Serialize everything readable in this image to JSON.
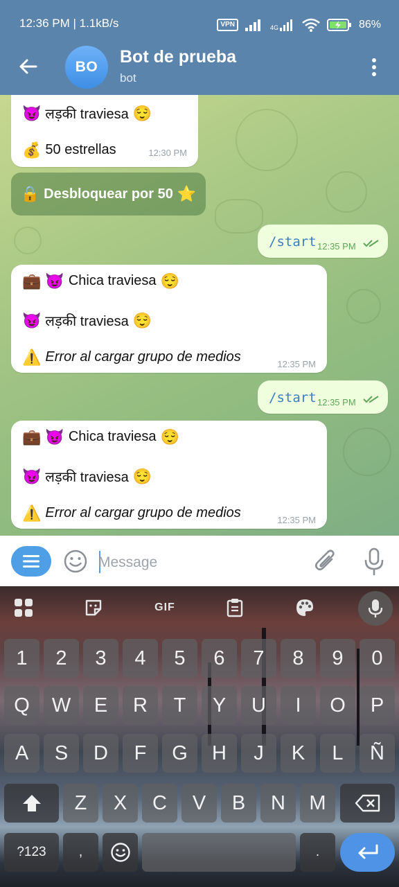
{
  "status_bar": {
    "time": "12:36 PM | 1.1kB/s",
    "vpn": "VPN",
    "network": "4G",
    "battery": "86%"
  },
  "header": {
    "avatar_initials": "BO",
    "title": "Bot de prueba",
    "subtitle": "bot"
  },
  "messages": {
    "partial": {
      "line1": "लड़की traviesa",
      "line2": "50 estrellas",
      "time": "12:30 PM"
    },
    "unlock_button": "Desbloquear por 50",
    "out1": {
      "text": "/start",
      "time": "12:35 PM"
    },
    "in1": {
      "line1": "Chica traviesa",
      "line2": "लड़की traviesa",
      "line3": "Error al cargar grupo de medios",
      "time": "12:35 PM"
    },
    "out2": {
      "text": "/start",
      "time": "12:35 PM"
    },
    "in2": {
      "line1": "Chica traviesa",
      "line2": "लड़की traviesa",
      "line3": "Error al cargar grupo de medios",
      "time": "12:35 PM"
    }
  },
  "composer": {
    "placeholder": "Message"
  },
  "keyboard": {
    "toolbar": {
      "gif": "GIF"
    },
    "row_numbers": [
      "1",
      "2",
      "3",
      "4",
      "5",
      "6",
      "7",
      "8",
      "9",
      "0"
    ],
    "row_q": [
      "Q",
      "W",
      "E",
      "R",
      "T",
      "Y",
      "U",
      "I",
      "O",
      "P"
    ],
    "row_a": [
      "A",
      "S",
      "D",
      "F",
      "G",
      "H",
      "J",
      "K",
      "L",
      "Ñ"
    ],
    "row_z": [
      "Z",
      "X",
      "C",
      "V",
      "B",
      "N",
      "M"
    ],
    "symbols": "?123",
    "comma": ",",
    "period": "."
  },
  "colors": {
    "header": "#5b84ad",
    "outgoing_bubble": "#effedd",
    "accent": "#4e9fe5"
  }
}
